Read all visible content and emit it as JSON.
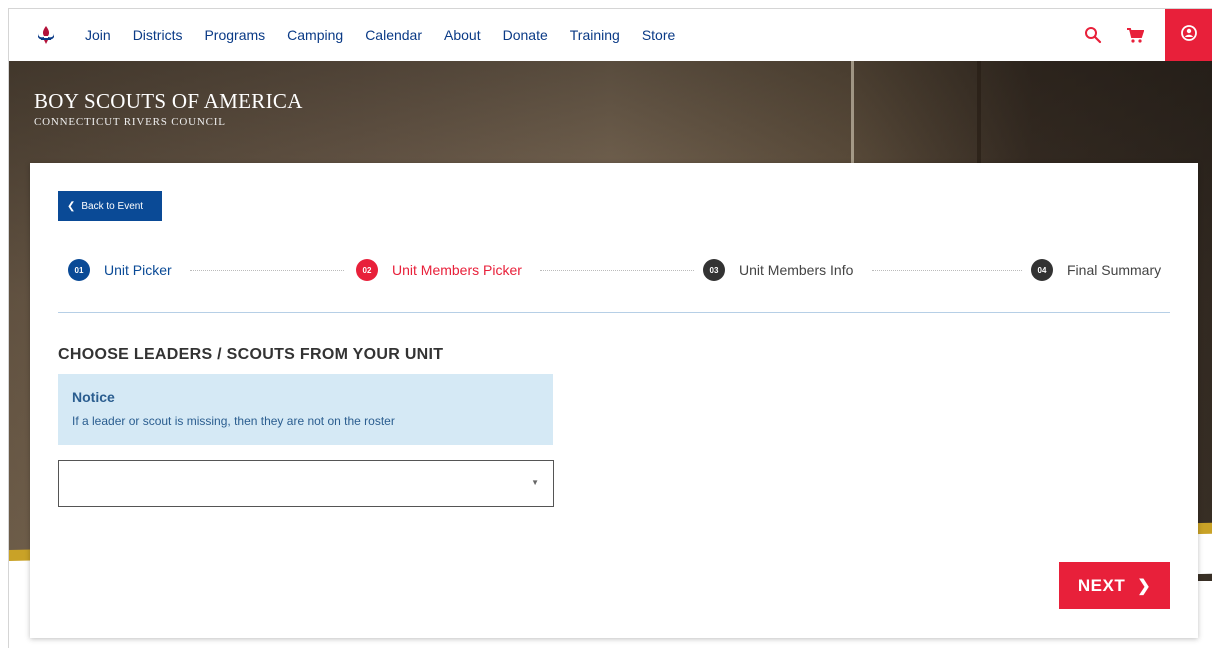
{
  "nav": {
    "logo_icon": "bsa-fleur-de-lis-icon",
    "links": [
      "Join",
      "Districts",
      "Programs",
      "Camping",
      "Calendar",
      "About",
      "Donate",
      "Training",
      "Store"
    ],
    "search_icon": "search-icon",
    "cart_icon": "cart-icon",
    "account_icon": "account-icon",
    "accent": "#e8203a",
    "link_color": "#0a3a86"
  },
  "hero": {
    "title": "BOY SCOUTS OF AMERICA",
    "subtitle": "CONNECTICUT RIVERS COUNCIL"
  },
  "card": {
    "back_label": "Back to Event",
    "steps": [
      {
        "num": "01",
        "label": "Unit Picker",
        "state": "done",
        "color": "#0a4a96"
      },
      {
        "num": "02",
        "label": "Unit Members Picker",
        "state": "active",
        "color": "#e8203a"
      },
      {
        "num": "03",
        "label": "Unit Members Info",
        "state": "todo",
        "color": "#333333"
      },
      {
        "num": "04",
        "label": "Final Summary",
        "state": "todo",
        "color": "#333333"
      }
    ],
    "heading": "CHOOSE LEADERS / SCOUTS FROM YOUR UNIT",
    "notice": {
      "title": "Notice",
      "text": "If a leader or scout is missing, then they are not on the roster"
    },
    "select_value": "",
    "next_label": "NEXT"
  }
}
